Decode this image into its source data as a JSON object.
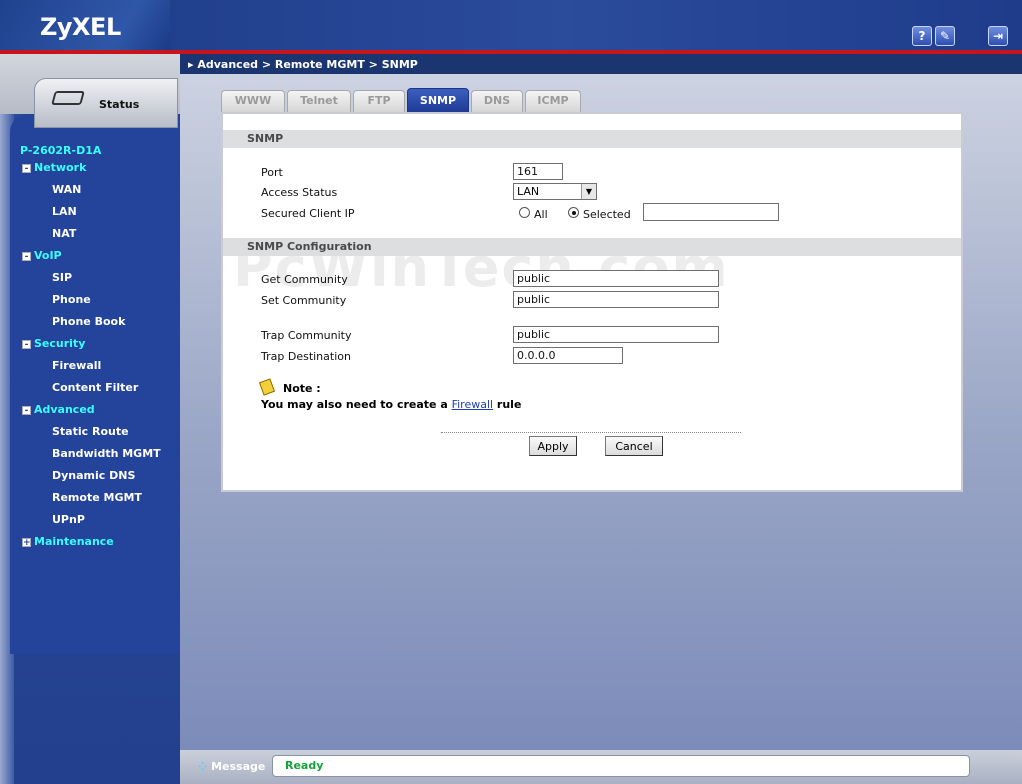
{
  "header": {
    "logo": "ZyXEL",
    "icons": [
      {
        "name": "help-icon",
        "glyph": "?"
      },
      {
        "name": "wizard-icon",
        "glyph": "✎"
      },
      {
        "name": "logout-icon",
        "glyph": "⇥"
      }
    ]
  },
  "sidebar": {
    "status_tab": "Status",
    "device": "P-2602R-D1A",
    "groups": [
      {
        "label": "Network",
        "toggle": "-",
        "items": [
          "WAN",
          "LAN",
          "NAT"
        ]
      },
      {
        "label": "VoIP",
        "toggle": "-",
        "items": [
          "SIP",
          "Phone",
          "Phone Book"
        ]
      },
      {
        "label": "Security",
        "toggle": "-",
        "items": [
          "Firewall",
          "Content Filter"
        ]
      },
      {
        "label": "Advanced",
        "toggle": "-",
        "items": [
          "Static Route",
          "Bandwidth MGMT",
          "Dynamic DNS",
          "Remote MGMT",
          "UPnP"
        ]
      },
      {
        "label": "Maintenance",
        "toggle": "+",
        "items": []
      }
    ]
  },
  "breadcrumb": "Advanced > Remote MGMT > SNMP",
  "tabs": [
    "WWW",
    "Telnet",
    "FTP",
    "SNMP",
    "DNS",
    "ICMP"
  ],
  "active_tab": "SNMP",
  "snmp": {
    "section_title": "SNMP",
    "port_label": "Port",
    "port_value": "161",
    "access_label": "Access Status",
    "access_value": "LAN",
    "client_label": "Secured Client IP",
    "radio_all": "All",
    "radio_selected": "Selected",
    "selected_option": "Selected",
    "client_ip_value": ""
  },
  "config": {
    "section_title": "SNMP Configuration",
    "get_label": "Get Community",
    "get_value": "public",
    "set_label": "Set Community",
    "set_value": "public",
    "trap_label": "Trap Community",
    "trap_value": "public",
    "dest_label": "Trap Destination",
    "dest_value": "0.0.0.0"
  },
  "note": {
    "title": "Note :",
    "prefix": "You may also need to create a",
    "link": "Firewall",
    "suffix": "rule"
  },
  "buttons": {
    "apply": "Apply",
    "cancel": "Cancel"
  },
  "watermark": "PcWinTech.com",
  "message": {
    "label": "Message",
    "text": "Ready"
  }
}
